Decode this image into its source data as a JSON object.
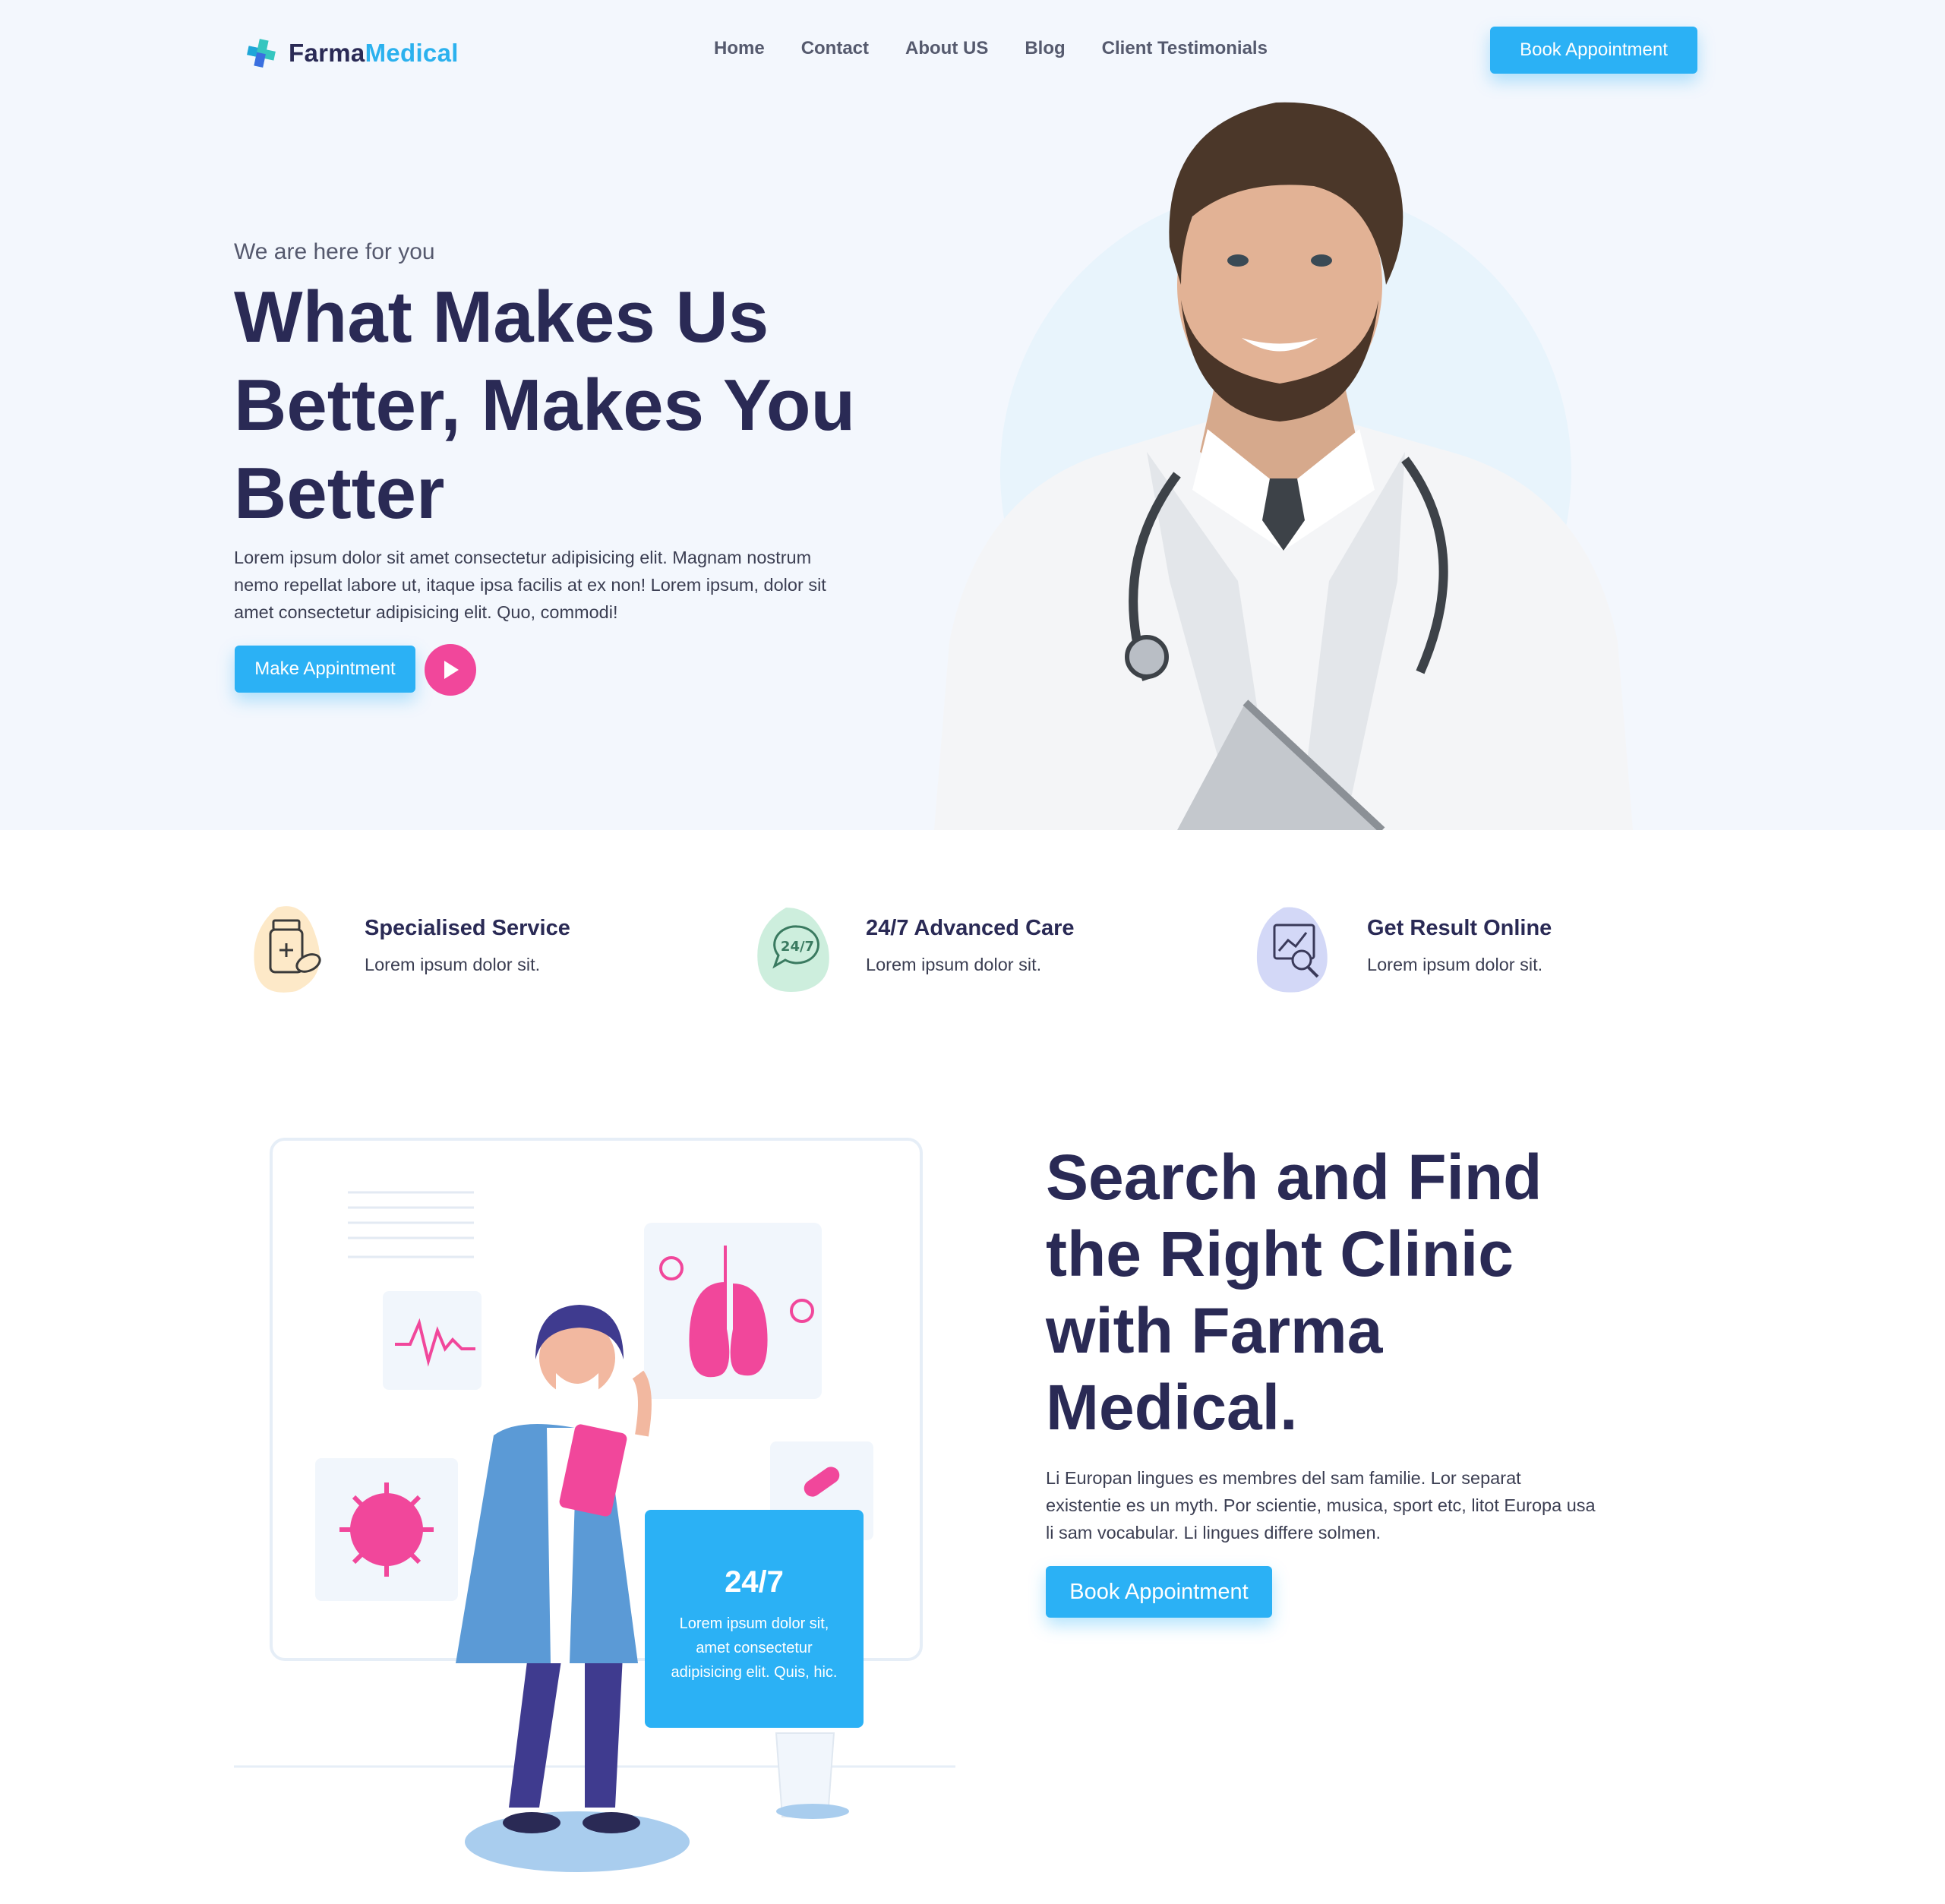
{
  "header": {
    "logo_part1": "Farma",
    "logo_part2": "Medical",
    "nav": [
      "Home",
      "Contact",
      "About US",
      "Blog",
      "Client Testimonials"
    ],
    "cta": "Book Appointment"
  },
  "hero": {
    "eyebrow": "We are here for you",
    "title_line1": "What Makes Us",
    "title_line2": "Better, Makes You",
    "title_line3": "Better",
    "description": "Lorem ipsum dolor sit amet consectetur adipisicing elit. Magnam nostrum nemo repellat labore ut, itaque ipsa facilis at ex non! Lorem ipsum, dolor sit amet consectetur adipisicing elit. Quo, commodi!",
    "cta": "Make Appintment"
  },
  "features": [
    {
      "title": "Specialised Service",
      "subtitle": "Lorem ipsum dolor sit.",
      "icon": "medicine-bottle-icon",
      "blob_color": "#fde9c8"
    },
    {
      "title": "24/7 Advanced Care",
      "subtitle": "Lorem ipsum dolor sit.",
      "icon": "chat-247-icon",
      "blob_color": "#cdeedd"
    },
    {
      "title": "Get Result Online",
      "subtitle": "Lorem ipsum dolor sit.",
      "icon": "chart-search-icon",
      "blob_color": "#d3d8f7"
    }
  ],
  "section2": {
    "card_big": "24/7",
    "card_small": "Lorem ipsum dolor sit, amet consectetur adipisicing elit. Quis, hic.",
    "title_line1": "Search and Find",
    "title_line2": "the Right Clinic",
    "title_line3": "with Farma",
    "title_line4": "Medical.",
    "description": "Li Europan lingues es membres del sam familie. Lor separat existentie es un myth. Por scientie, musica, sport etc, litot Europa usa li sam vocabular. Li lingues differe solmen.",
    "cta": "Book Appointment"
  },
  "colors": {
    "accent": "#2bb1f5",
    "heading": "#2a2a55",
    "pink": "#f1479b",
    "hero_bg": "#f3f7fd"
  }
}
